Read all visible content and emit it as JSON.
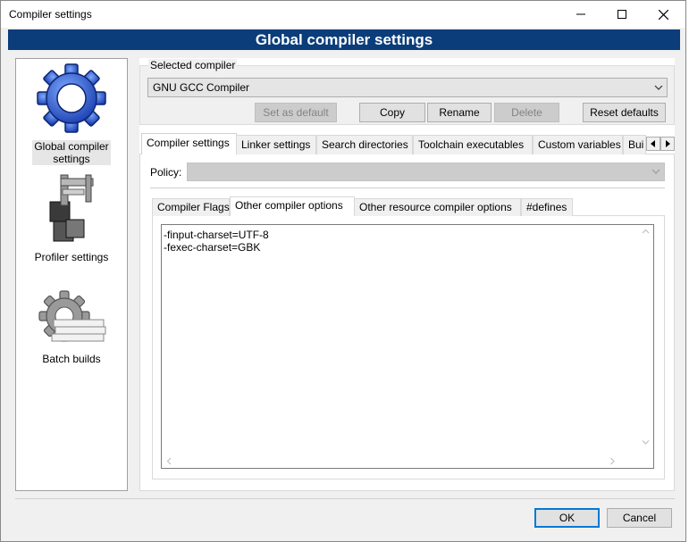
{
  "window": {
    "title": "Compiler settings"
  },
  "banner": {
    "title": "Global compiler settings"
  },
  "nav": {
    "items": [
      {
        "label_line1": "Global compiler",
        "label_line2": "settings",
        "icon": "gear-icon",
        "selected": true
      },
      {
        "label_line1": "Profiler settings",
        "label_line2": "",
        "icon": "caliper-icon",
        "selected": false
      },
      {
        "label_line1": "Batch builds",
        "label_line2": "",
        "icon": "batch-gear-icon",
        "selected": false
      }
    ]
  },
  "compiler": {
    "group_label": "Selected compiler",
    "selected": "GNU GCC Compiler",
    "buttons": {
      "set_default": "Set as default",
      "copy": "Copy",
      "rename": "Rename",
      "delete": "Delete",
      "reset": "Reset defaults"
    }
  },
  "tabs": {
    "items": [
      "Compiler settings",
      "Linker settings",
      "Search directories",
      "Toolchain executables",
      "Custom variables",
      "Bui"
    ],
    "active": 0
  },
  "policy": {
    "label": "Policy:",
    "value": ""
  },
  "subtabs": {
    "items": [
      "Compiler Flags",
      "Other compiler options",
      "Other resource compiler options",
      "#defines"
    ],
    "active": 1
  },
  "options_text": {
    "lines": [
      "-finput-charset=UTF-8",
      "-fexec-charset=GBK"
    ]
  },
  "footer": {
    "ok": "OK",
    "cancel": "Cancel"
  },
  "colors": {
    "banner_bg": "#0a3d7a",
    "accent": "#0078d7"
  }
}
